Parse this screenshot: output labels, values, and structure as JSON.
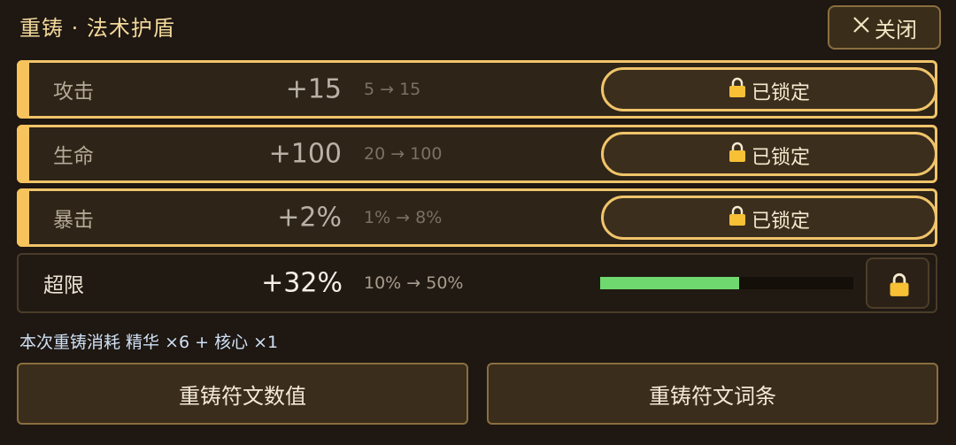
{
  "header": {
    "title": "重铸 · 法术护盾",
    "close_label": "关闭"
  },
  "stats": [
    {
      "name": "攻击",
      "value": "+15",
      "range": "5 → 15",
      "locked": true,
      "lock_label": "已锁定"
    },
    {
      "name": "生命",
      "value": "+100",
      "range": "20 → 100",
      "locked": true,
      "lock_label": "已锁定"
    },
    {
      "name": "暴击",
      "value": "+2%",
      "range": "1% → 8%",
      "locked": true,
      "lock_label": "已锁定"
    },
    {
      "name": "超限",
      "value": "+32%",
      "range": "10% → 50%",
      "locked": false,
      "progress": 0.55
    }
  ],
  "cost_text": "本次重铸消耗 精华 ×6 + 核心 ×1",
  "actions": {
    "reforge_values": "重铸符文数值",
    "reforge_affixes": "重铸符文词条"
  },
  "colors": {
    "accent": "#f0c46a",
    "progress": "#6fd86e",
    "lock_icon": "#f7c035"
  },
  "icons": {
    "close": "close-icon",
    "lock": "lock-icon"
  }
}
